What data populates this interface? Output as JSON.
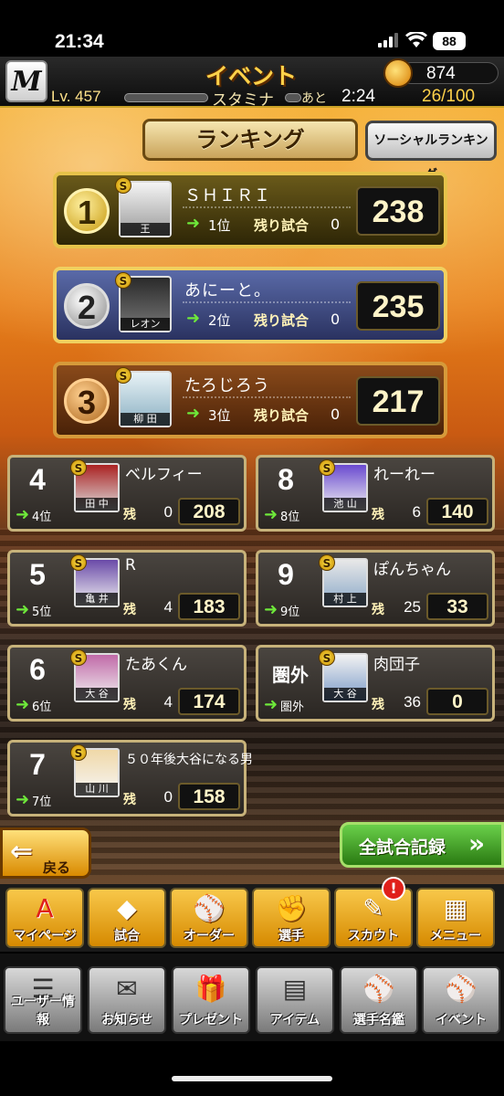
{
  "status": {
    "time": "21:34",
    "battery": "88"
  },
  "header": {
    "logo": "M",
    "title": "イベント",
    "coins": "874",
    "level_label": "Lv.",
    "level": "457",
    "stamina_label": "スタミナ",
    "recover_label": "あと",
    "recover_time": "2:24",
    "stamina": "26/100"
  },
  "tabs": {
    "ranking": "ランキング",
    "social": "ソーシャルランキング"
  },
  "labels": {
    "remaining": "残り試合",
    "remaining_short": "残"
  },
  "top3": [
    {
      "medal": "1",
      "name": "ＳＨＩＲＩ",
      "avatar_name": "王",
      "rank": "1位",
      "remaining": "0",
      "score": "238"
    },
    {
      "medal": "2",
      "name": "あにーと。",
      "avatar_name": "レオン",
      "rank": "2位",
      "remaining": "0",
      "score": "235"
    },
    {
      "medal": "3",
      "name": "たろじろう",
      "avatar_name": "柳 田",
      "rank": "3位",
      "remaining": "0",
      "score": "217"
    }
  ],
  "left_list": [
    {
      "rank_num": "4",
      "rank": "4位",
      "name": "ベルフィー",
      "avatar_name": "田 中",
      "remaining": "0",
      "score": "208"
    },
    {
      "rank_num": "5",
      "rank": "5位",
      "name": "R",
      "avatar_name": "亀 井",
      "remaining": "4",
      "score": "183"
    },
    {
      "rank_num": "6",
      "rank": "6位",
      "name": "たあくん",
      "avatar_name": "大 谷",
      "remaining": "4",
      "score": "174"
    },
    {
      "rank_num": "7",
      "rank": "7位",
      "name": "５０年後大谷になる男",
      "avatar_name": "山 川",
      "remaining": "0",
      "score": "158"
    }
  ],
  "right_list": [
    {
      "rank_num": "8",
      "rank": "8位",
      "name": "れーれー",
      "avatar_name": "池 山",
      "remaining": "6",
      "score": "140"
    },
    {
      "rank_num": "9",
      "rank": "9位",
      "name": "ぽんちゃん",
      "avatar_name": "村 上",
      "remaining": "25",
      "score": "33"
    },
    {
      "rank_num": "圏外",
      "rank": "圏外",
      "name": "肉団子",
      "avatar_name": "大 谷",
      "remaining": "36",
      "score": "0"
    }
  ],
  "buttons": {
    "back": "戻る",
    "all_games": "全試合記録"
  },
  "nav_primary": [
    {
      "label": "マイページ",
      "icon": "A"
    },
    {
      "label": "試合",
      "icon": "◆"
    },
    {
      "label": "オーダー",
      "icon": "⚾"
    },
    {
      "label": "選手",
      "icon": "✊"
    },
    {
      "label": "スカウト",
      "icon": "✎"
    },
    {
      "label": "メニュー",
      "icon": "▦"
    }
  ],
  "nav_secondary": [
    {
      "label": "ユーザー情報",
      "icon": "☰"
    },
    {
      "label": "お知らせ",
      "icon": "✉"
    },
    {
      "label": "プレゼント",
      "icon": "🎁"
    },
    {
      "label": "アイテム",
      "icon": "▤"
    },
    {
      "label": "選手名鑑",
      "icon": "⚾"
    },
    {
      "label": "イベント",
      "icon": "⚾"
    }
  ],
  "scout_alert": "!"
}
